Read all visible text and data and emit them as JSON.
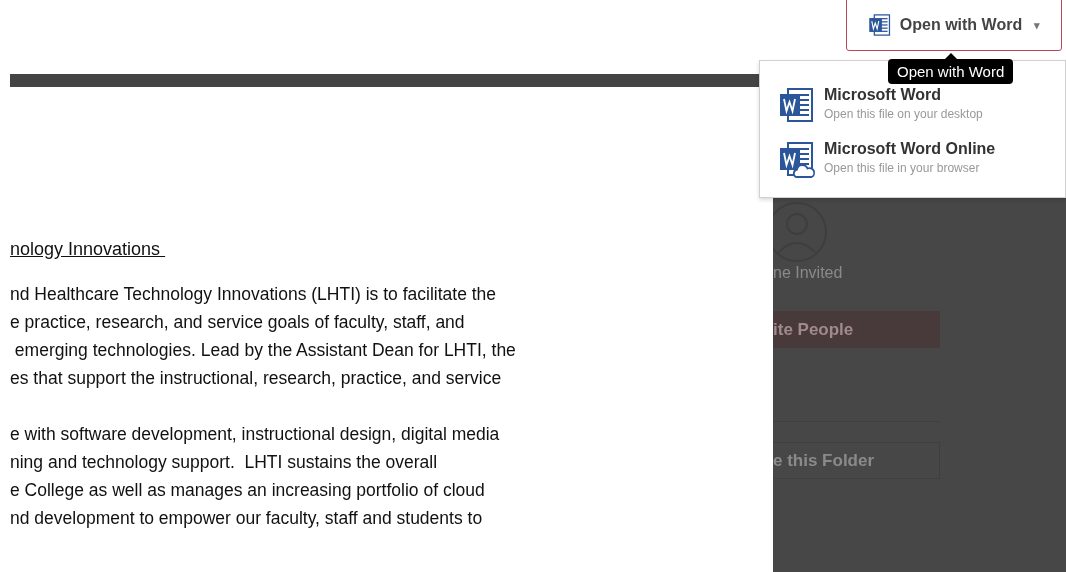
{
  "open_button": {
    "label": "Open with Word",
    "caret": "▾"
  },
  "tooltip": {
    "text": "Open with Word"
  },
  "open_menu": {
    "items": [
      {
        "kind": "desktop",
        "title": "Microsoft Word",
        "subtitle": "Open this file on your desktop"
      },
      {
        "kind": "online",
        "title": "Microsoft Word Online",
        "subtitle": "Open this file in your browser"
      }
    ]
  },
  "document": {
    "heading": "nology Innovations ",
    "paragraphs": [
      {
        "lines": [
          "nd Healthcare Technology Innovations (LHTI) is to facilitate the",
          "e practice, research, and service goals of faculty, staff, and",
          " emerging technologies. Lead by the Assistant Dean for LHTI, the",
          "es that support the instructional, research, practice, and service"
        ]
      },
      {
        "lines": [
          "e with software development, instructional design, digital media",
          "ning and technology support.  LHTI sustains the overall",
          "e College as well as manages an increasing portfolio of cloud",
          "nd development to empower our faculty, staff and students to"
        ]
      }
    ]
  },
  "sidebar": {
    "invited": "ne Invited",
    "invite_button": "ite People",
    "share_button": "e this Folder"
  }
}
